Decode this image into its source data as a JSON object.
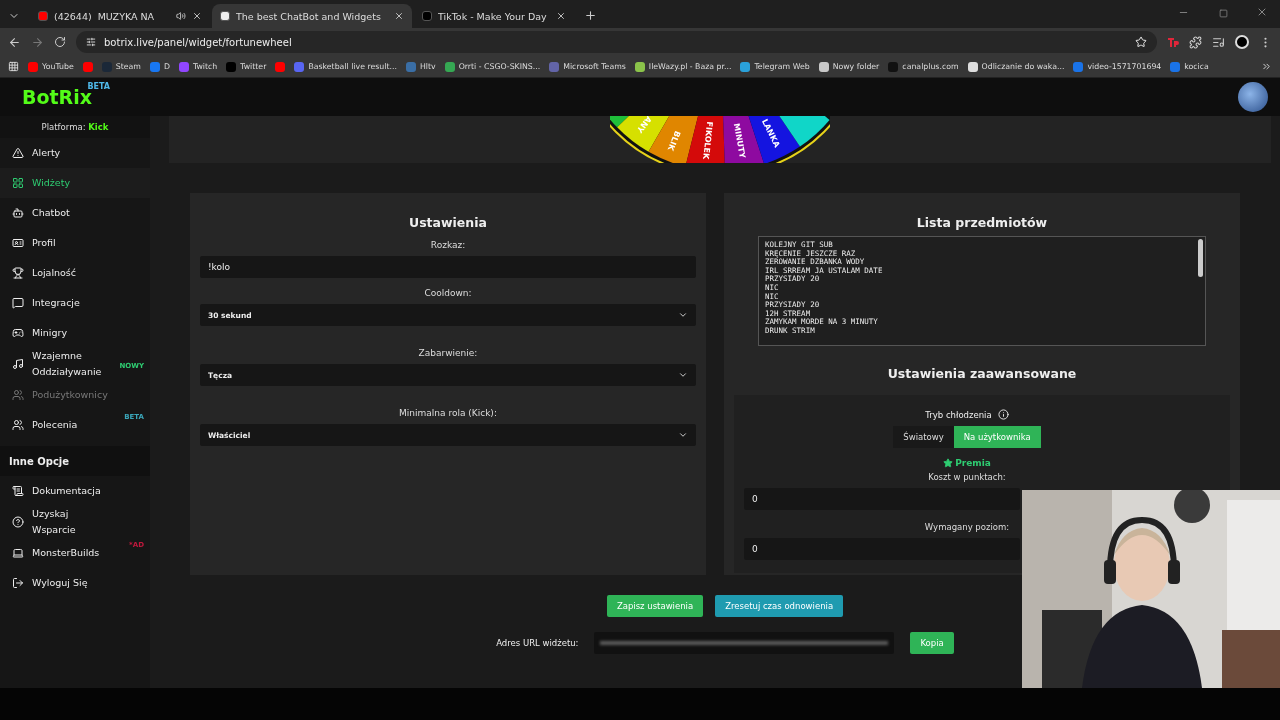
{
  "browser": {
    "tabs": [
      {
        "count": "(42644)",
        "label": "MUZYKA NA",
        "selected": false,
        "muted": true
      },
      {
        "label": "The best ChatBot and Widgets",
        "selected": true,
        "muted": false
      },
      {
        "label": "TikTok - Make Your Day",
        "selected": false,
        "muted": false
      }
    ],
    "address": "botrix.live/panel/widget/fortunewheel",
    "bookmarks": [
      {
        "label": "YouTube",
        "color": "#ff0000"
      },
      {
        "color": "#ff0000"
      },
      {
        "label": "Steam",
        "color": "#1b2838"
      },
      {
        "label": "D",
        "color": "#1877f2"
      },
      {
        "label": "Twitch",
        "color": "#9146ff"
      },
      {
        "label": "Twitter",
        "color": "#000000"
      },
      {
        "color": "#ff0000"
      },
      {
        "label": "Basketball live result...",
        "color": "#5865f2"
      },
      {
        "label": "Hltv",
        "color": "#3a6ea5"
      },
      {
        "label": "Orrti - CSGO-SKINS...",
        "color": "#35a853"
      },
      {
        "label": "Microsoft Teams",
        "color": "#6264a7"
      },
      {
        "label": "IleWazy.pl - Baza pr...",
        "color": "#8bc34a"
      },
      {
        "label": "Telegram Web",
        "color": "#2aa1da"
      },
      {
        "label": "Nowy folder",
        "color": "#c8c8c8"
      },
      {
        "label": "canalplus.com",
        "color": "#111111"
      },
      {
        "label": "Odliczanie do waka...",
        "color": "#dddddd"
      },
      {
        "label": "video-1571701694",
        "color": "#1a73e8"
      },
      {
        "label": "kocica",
        "color": "#1a73e8"
      }
    ]
  },
  "app": {
    "logo": "BotRix",
    "logo_badge": "BETA",
    "platform_label": "Platforma:",
    "platform": "Kick"
  },
  "sidebar": {
    "items": [
      {
        "label": "Alerty",
        "selected": false,
        "disabled": false
      },
      {
        "label": "Widżety",
        "selected": true,
        "disabled": false
      },
      {
        "label": "Chatbot",
        "selected": false,
        "disabled": false
      },
      {
        "label": "Profil",
        "selected": false,
        "disabled": false
      },
      {
        "label": "Lojalność",
        "selected": false,
        "disabled": false
      },
      {
        "label": "Integracje",
        "selected": false,
        "disabled": false
      },
      {
        "label": "Minigry",
        "selected": false,
        "disabled": false
      },
      {
        "label": "Wzajemne Oddziaływanie",
        "selected": false,
        "disabled": false,
        "badge": {
          "text": "NOWY",
          "color": "#2ecc71"
        }
      },
      {
        "label": "Podużytkownicy",
        "selected": false,
        "disabled": true
      },
      {
        "label": "Polecenia",
        "selected": false,
        "disabled": false,
        "badge": {
          "text": "BETA",
          "color": "#3aa6b9"
        }
      }
    ],
    "section": "Inne Opcje",
    "other_items": [
      {
        "label": "Dokumentacja",
        "selected": false,
        "disabled": false
      },
      {
        "label": "Uzyskaj Wsparcie",
        "selected": false,
        "disabled": false
      },
      {
        "label": "MonsterBuilds",
        "selected": false,
        "disabled": false,
        "badge": {
          "text": "*AD",
          "color": "#c0183c"
        }
      },
      {
        "label": "Wyloguj Się",
        "selected": false,
        "disabled": false
      }
    ]
  },
  "wheel": {
    "segments": [
      {
        "color": "#1fbf3a"
      },
      {
        "label": "ANY",
        "color": "#d6e000"
      },
      {
        "label": "BLIK",
        "color": "#e08600"
      },
      {
        "label": "FIKOLEK",
        "color": "#d40a0a"
      },
      {
        "label": "MINUTY",
        "color": "#8e0aa0"
      },
      {
        "label": "LANKA",
        "color": "#1414e0"
      },
      {
        "color": "#10d6c8"
      }
    ]
  },
  "settings": {
    "title": "Ustawienia",
    "fields": [
      {
        "kind": "input",
        "label": "Rozkaz:",
        "value": "!kolo"
      },
      {
        "kind": "select",
        "label": "Cooldown:",
        "value": "30 sekund"
      },
      {
        "kind": "select",
        "label": "Zabarwienie:",
        "value": "Tęcza"
      },
      {
        "kind": "select",
        "label": "Minimalna rola (Kick):",
        "value": "Właściciel"
      }
    ]
  },
  "items_list": {
    "title": "Lista przedmiotów",
    "lines": [
      "KOLEJNY GIT SUB",
      "KRĘCENIE JESZCZE RAZ",
      "ZEROWANIE DZBANKA WODY",
      "IRL SRREAM JA USTALAM DATE",
      "PRZYSIADY 20",
      "NIC",
      "NIC",
      "PRZYSIADY 20",
      "12H STREAM",
      "ZAMYKAM MORDE NA 3 MINUTY",
      "DRUNK STRIM"
    ]
  },
  "advanced": {
    "title": "Ustawienia zaawansowane",
    "cooldown_label": "Tryb chłodzenia",
    "modes": [
      {
        "label": "Światowy",
        "selected": false
      },
      {
        "label": "Na użytkownika",
        "selected": true
      }
    ],
    "premium": "Premia",
    "fields": [
      {
        "label": "Koszt w punktach:",
        "value": "0"
      },
      {
        "label": "Wymagany poziom:",
        "value": "0"
      }
    ]
  },
  "actions": [
    {
      "label": "Zapisz ustawienia",
      "color": "#2fb457"
    },
    {
      "label": "Zresetuj czas odnowienia",
      "color": "#1f9bb0"
    }
  ],
  "url_row": {
    "label": "Adres URL widżetu:",
    "copy": "Kopia"
  }
}
